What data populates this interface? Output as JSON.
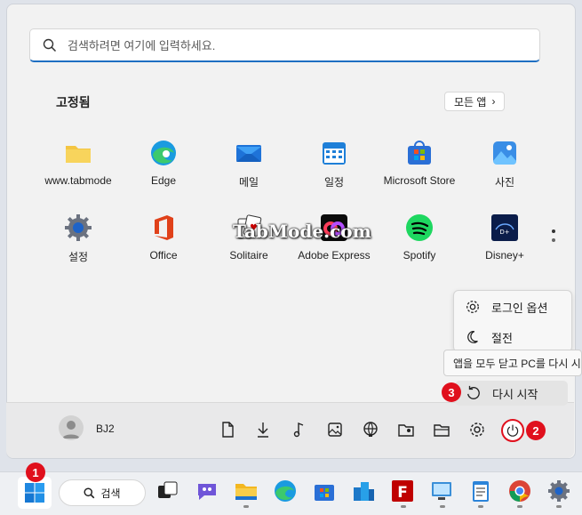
{
  "search": {
    "placeholder": "검색하려면 여기에 입력하세요."
  },
  "pinned": {
    "title": "고정됨",
    "all_apps_label": "모든 앱",
    "apps": [
      {
        "label": "www.tabmode",
        "icon": "folder-icon"
      },
      {
        "label": "Edge",
        "icon": "edge-icon"
      },
      {
        "label": "메일",
        "icon": "mail-icon"
      },
      {
        "label": "일정",
        "icon": "calendar-icon"
      },
      {
        "label": "Microsoft Store",
        "icon": "store-icon"
      },
      {
        "label": "사진",
        "icon": "photos-icon"
      },
      {
        "label": "설정",
        "icon": "settings-icon"
      },
      {
        "label": "Office",
        "icon": "office-icon"
      },
      {
        "label": "Solitaire",
        "icon": "solitaire-icon"
      },
      {
        "label": "Adobe Express",
        "icon": "adobe-express-icon"
      },
      {
        "label": "Spotify",
        "icon": "spotify-icon"
      },
      {
        "label": "Disney+",
        "icon": "disney-plus-icon"
      }
    ]
  },
  "watermark": "TabMode.com",
  "footer": {
    "user_name": "BJ2"
  },
  "power_menu": {
    "items": [
      "로그인 옵션",
      "절전",
      "다시 시작"
    ],
    "tooltip": "앱을 모두 닫고 PC를 다시 시작합니다."
  },
  "badges": {
    "start": "1",
    "power": "2",
    "restart": "3"
  },
  "taskbar": {
    "search_label": "검색"
  },
  "colors": {
    "accent": "#1f6fc2",
    "badge": "#e0101d"
  }
}
